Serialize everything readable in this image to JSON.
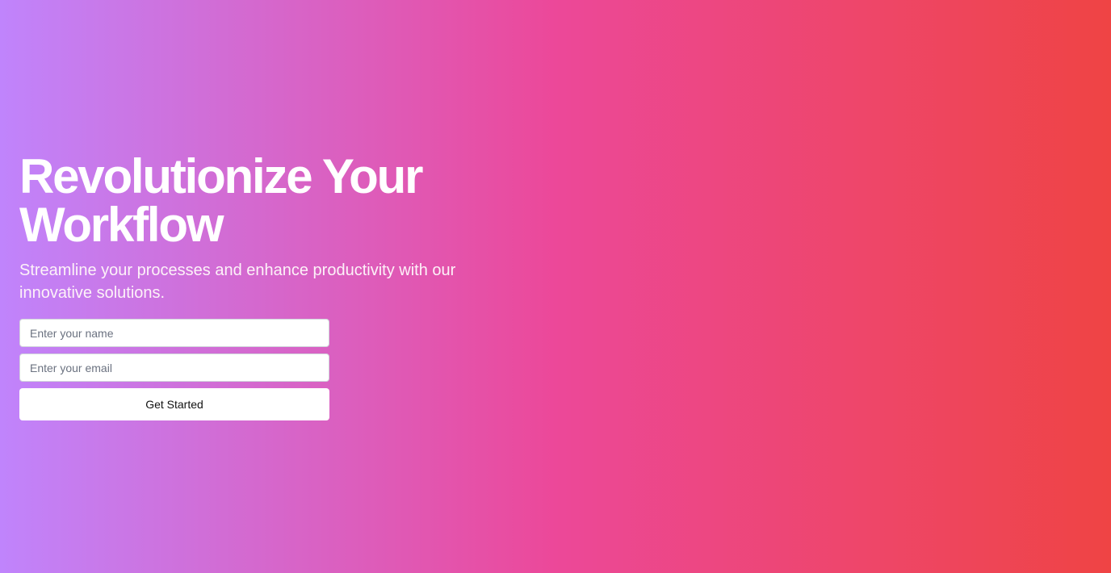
{
  "hero": {
    "headline": "Revolutionize Your Workflow",
    "subheadline": "Streamline your processes and enhance productivity with our innovative solutions.",
    "background_gradient": [
      "#c084fc",
      "#ec4899",
      "#ef4444"
    ]
  },
  "form": {
    "name_placeholder": "Enter your name",
    "name_value": "",
    "email_placeholder": "Enter your email",
    "email_value": "",
    "submit_label": "Get Started"
  }
}
